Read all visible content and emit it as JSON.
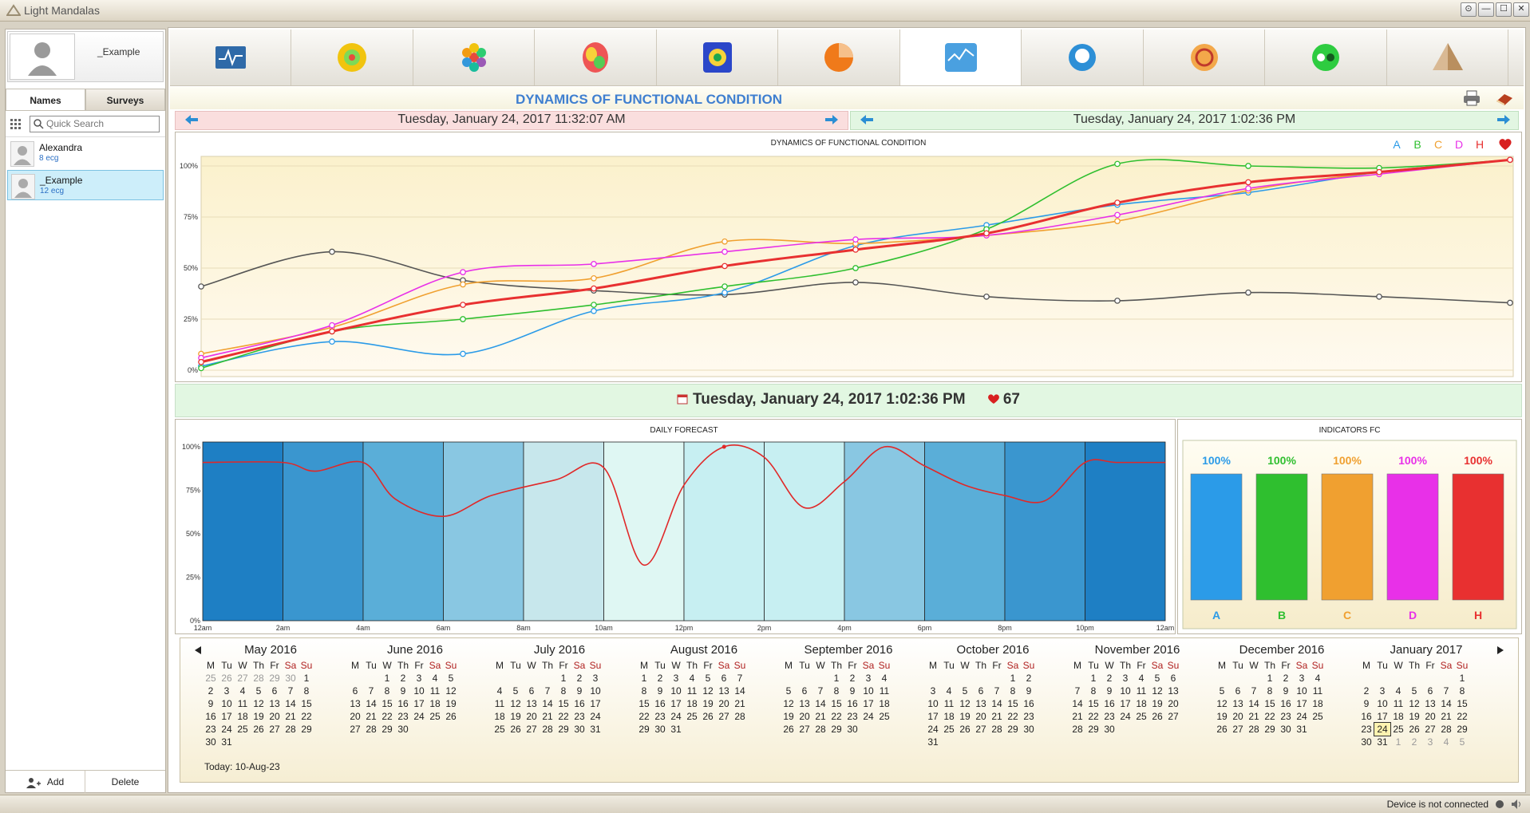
{
  "window": {
    "title": "Light Mandalas",
    "controls": [
      "⊙",
      "—",
      "☐",
      "✕"
    ]
  },
  "left": {
    "profile_name": "_Example",
    "tabs": [
      "Names",
      "Surveys"
    ],
    "search_placeholder": "Quick Search",
    "people": [
      {
        "name": "Alexandra",
        "count": "8 ecg"
      },
      {
        "name": "_Example",
        "count": "12 ecg"
      }
    ],
    "add_label": "Add",
    "delete_label": "Delete"
  },
  "modebar": {
    "icons": [
      "cardio-monitor-icon",
      "energy-sphere-icon",
      "hexagon-cluster-icon",
      "brain-map-icon",
      "body-chakra-icon",
      "pie-chart-icon",
      "dynamics-chart-icon",
      "head-profile-icon",
      "om-symbol-icon",
      "yin-yang-icon",
      "pyramid-icon"
    ],
    "active_index": 6
  },
  "page": {
    "title": "DYNAMICS OF FUNCTIONAL CONDITION",
    "date_left": "Tuesday, January 24, 2017 11:32:07 AM",
    "date_right": "Tuesday, January 24, 2017 1:02:36 PM",
    "selected": "Tuesday, January 24, 2017 1:02:36 PM",
    "heart_value": "67"
  },
  "colors": {
    "A": "#2b9be8",
    "B": "#2fbf2f",
    "C": "#f0a030",
    "D": "#e830e8",
    "H": "#e83030",
    "gray": "#555555"
  },
  "chart_data": [
    {
      "type": "line",
      "title": "DYNAMICS OF FUNCTIONAL CONDITION",
      "ylim": [
        0,
        100
      ],
      "y_ticks": [
        "0%",
        "25%",
        "50%",
        "75%",
        "100%"
      ],
      "legend": [
        "A",
        "B",
        "C",
        "D",
        "H"
      ],
      "legend_position": "top-right",
      "x": [
        0,
        1,
        2,
        3,
        4,
        5,
        6,
        7,
        8,
        9,
        10
      ],
      "series": [
        {
          "name": "gray",
          "values": [
            41,
            58,
            44,
            39,
            37,
            43,
            36,
            34,
            38,
            36,
            33
          ]
        },
        {
          "name": "A",
          "values": [
            2,
            14,
            8,
            29,
            38,
            61,
            71,
            81,
            87,
            97,
            103
          ]
        },
        {
          "name": "B",
          "values": [
            1,
            19,
            25,
            32,
            41,
            50,
            69,
            101,
            100,
            99,
            103
          ]
        },
        {
          "name": "C",
          "values": [
            8,
            21,
            42,
            45,
            63,
            62,
            66,
            73,
            88,
            97,
            103
          ]
        },
        {
          "name": "D",
          "values": [
            6,
            22,
            48,
            52,
            58,
            64,
            66,
            76,
            89,
            96,
            103
          ]
        },
        {
          "name": "H",
          "values": [
            4,
            19,
            32,
            40,
            51,
            59,
            67,
            82,
            92,
            97,
            103
          ]
        }
      ]
    },
    {
      "type": "line",
      "title": "DAILY FORECAST",
      "ylim": [
        0,
        100
      ],
      "y_ticks": [
        "0%",
        "25%",
        "50%",
        "75%",
        "100%"
      ],
      "x_ticks": [
        "12am",
        "2am",
        "4am",
        "6am",
        "8am",
        "10am",
        "12pm",
        "2pm",
        "4pm",
        "6pm",
        "8pm",
        "10pm",
        "12am"
      ],
      "x": [
        0,
        1,
        1.4,
        2,
        2.4,
        3,
        3.6,
        4.4,
        5,
        5.5,
        6,
        6.5,
        7,
        7.5,
        8,
        8.5,
        9,
        9.5,
        10,
        10.5,
        11,
        11.4,
        12
      ],
      "series": [
        {
          "name": "forecast",
          "values": [
            91,
            91,
            86,
            91,
            70,
            60,
            72,
            81,
            88,
            32,
            78,
            100,
            94,
            65,
            80,
            100,
            89,
            78,
            72,
            69,
            91,
            91,
            91
          ]
        }
      ]
    },
    {
      "type": "bar",
      "title": "INDICATORS FC",
      "categories": [
        "A",
        "B",
        "C",
        "D",
        "H"
      ],
      "values": [
        100,
        100,
        100,
        100,
        100
      ],
      "labels": [
        "100%",
        "100%",
        "100%",
        "100%",
        "100%"
      ]
    }
  ],
  "calendar": {
    "today_label": "Today: 10-Aug-23",
    "weekdays": [
      "M",
      "Tu",
      "W",
      "Th",
      "Fr",
      "Sa",
      "Su"
    ],
    "months": [
      {
        "title": "May 2016",
        "rows": [
          [
            "25",
            "26",
            "27",
            "28",
            "29",
            "30",
            "1"
          ],
          [
            "2",
            "3",
            "4",
            "5",
            "6",
            "7",
            "8"
          ],
          [
            "9",
            "10",
            "11",
            "12",
            "13",
            "14",
            "15"
          ],
          [
            "16",
            "17",
            "18",
            "19",
            "20",
            "21",
            "22"
          ],
          [
            "23",
            "24",
            "25",
            "26",
            "27",
            "28",
            "29"
          ],
          [
            "30",
            "31",
            "",
            "",
            "",
            "",
            ""
          ]
        ]
      },
      {
        "title": "June 2016",
        "rows": [
          [
            "",
            "",
            "1",
            "2",
            "3",
            "4",
            "5"
          ],
          [
            "6",
            "7",
            "8",
            "9",
            "10",
            "11",
            "12"
          ],
          [
            "13",
            "14",
            "15",
            "16",
            "17",
            "18",
            "19"
          ],
          [
            "20",
            "21",
            "22",
            "23",
            "24",
            "25",
            "26"
          ],
          [
            "27",
            "28",
            "29",
            "30",
            "",
            "",
            ""
          ]
        ]
      },
      {
        "title": "July 2016",
        "rows": [
          [
            "",
            "",
            "",
            "",
            "1",
            "2",
            "3"
          ],
          [
            "4",
            "5",
            "6",
            "7",
            "8",
            "9",
            "10"
          ],
          [
            "11",
            "12",
            "13",
            "14",
            "15",
            "16",
            "17"
          ],
          [
            "18",
            "19",
            "20",
            "21",
            "22",
            "23",
            "24"
          ],
          [
            "25",
            "26",
            "27",
            "28",
            "29",
            "30",
            "31"
          ]
        ]
      },
      {
        "title": "August 2016",
        "rows": [
          [
            "1",
            "2",
            "3",
            "4",
            "5",
            "6",
            "7"
          ],
          [
            "8",
            "9",
            "10",
            "11",
            "12",
            "13",
            "14"
          ],
          [
            "15",
            "16",
            "17",
            "18",
            "19",
            "20",
            "21"
          ],
          [
            "22",
            "23",
            "24",
            "25",
            "26",
            "27",
            "28"
          ],
          [
            "29",
            "30",
            "31",
            "",
            "",
            "",
            ""
          ]
        ]
      },
      {
        "title": "September 2016",
        "rows": [
          [
            "",
            "",
            "",
            "1",
            "2",
            "3",
            "4"
          ],
          [
            "5",
            "6",
            "7",
            "8",
            "9",
            "10",
            "11"
          ],
          [
            "12",
            "13",
            "14",
            "15",
            "16",
            "17",
            "18"
          ],
          [
            "19",
            "20",
            "21",
            "22",
            "23",
            "24",
            "25"
          ],
          [
            "26",
            "27",
            "28",
            "29",
            "30",
            "",
            ""
          ]
        ]
      },
      {
        "title": "October 2016",
        "rows": [
          [
            "",
            "",
            "",
            "",
            "",
            "1",
            "2"
          ],
          [
            "3",
            "4",
            "5",
            "6",
            "7",
            "8",
            "9"
          ],
          [
            "10",
            "11",
            "12",
            "13",
            "14",
            "15",
            "16"
          ],
          [
            "17",
            "18",
            "19",
            "20",
            "21",
            "22",
            "23"
          ],
          [
            "24",
            "25",
            "26",
            "27",
            "28",
            "29",
            "30"
          ],
          [
            "31",
            "",
            "",
            "",
            "",
            "",
            ""
          ]
        ]
      },
      {
        "title": "November 2016",
        "rows": [
          [
            "",
            "1",
            "2",
            "3",
            "4",
            "5",
            "6"
          ],
          [
            "7",
            "8",
            "9",
            "10",
            "11",
            "12",
            "13"
          ],
          [
            "14",
            "15",
            "16",
            "17",
            "18",
            "19",
            "20"
          ],
          [
            "21",
            "22",
            "23",
            "24",
            "25",
            "26",
            "27"
          ],
          [
            "28",
            "29",
            "30",
            "",
            "",
            "",
            ""
          ]
        ]
      },
      {
        "title": "December 2016",
        "rows": [
          [
            "",
            "",
            "",
            "1",
            "2",
            "3",
            "4"
          ],
          [
            "5",
            "6",
            "7",
            "8",
            "9",
            "10",
            "11"
          ],
          [
            "12",
            "13",
            "14",
            "15",
            "16",
            "17",
            "18"
          ],
          [
            "19",
            "20",
            "21",
            "22",
            "23",
            "24",
            "25"
          ],
          [
            "26",
            "27",
            "28",
            "29",
            "30",
            "31",
            ""
          ]
        ]
      },
      {
        "title": "January 2017",
        "rows": [
          [
            "",
            "",
            "",
            "",
            "",
            "",
            "1"
          ],
          [
            "2",
            "3",
            "4",
            "5",
            "6",
            "7",
            "8"
          ],
          [
            "9",
            "10",
            "11",
            "12",
            "13",
            "14",
            "15"
          ],
          [
            "16",
            "17",
            "18",
            "19",
            "20",
            "21",
            "22"
          ],
          [
            "23",
            "24",
            "25",
            "26",
            "27",
            "28",
            "29"
          ],
          [
            "30",
            "31",
            "1",
            "2",
            "3",
            "4",
            "5"
          ]
        ]
      }
    ]
  },
  "status": {
    "text": "Device is not connected"
  }
}
